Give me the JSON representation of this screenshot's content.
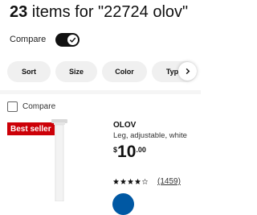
{
  "results": {
    "count": "23",
    "text": " items for \"22724 olov\""
  },
  "compare_toggle": {
    "label": "Compare",
    "state": "on"
  },
  "filters": [
    {
      "label": "Sort"
    },
    {
      "label": "Size"
    },
    {
      "label": "Color"
    },
    {
      "label": "Type"
    }
  ],
  "product": {
    "compare_label": "Compare",
    "badge": "Best seller",
    "name": "OLOV",
    "description": "Leg, adjustable, white",
    "price": {
      "currency": "$",
      "main": "10",
      "cents": ".00"
    },
    "rating": 4,
    "reviews": "(1459)"
  },
  "colors": {
    "badge": "#cc0008",
    "accent_blue": "#0058a3",
    "pill_bg": "#f0f0f0"
  },
  "icons": [
    "checkmark-icon",
    "chevron-right-icon",
    "star-icon",
    "cart-icon"
  ]
}
